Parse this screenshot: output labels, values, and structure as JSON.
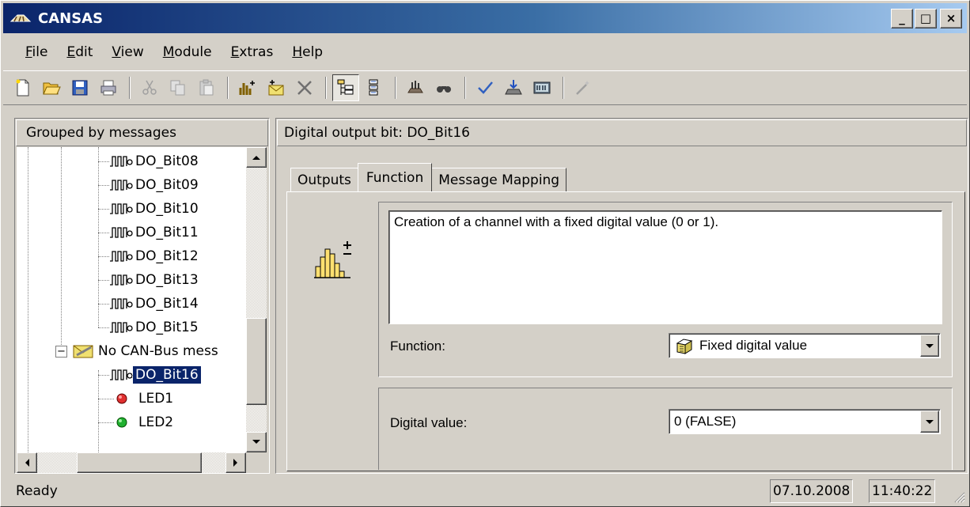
{
  "app": {
    "title": "CANSAS",
    "icon": "cansas-app-icon"
  },
  "window_buttons": {
    "minimize": "_",
    "maximize": "□",
    "close": "×"
  },
  "menu": {
    "items": [
      {
        "label": "File",
        "key": "F",
        "rest": "ile"
      },
      {
        "label": "Edit",
        "key": "E",
        "rest": "dit"
      },
      {
        "label": "View",
        "key": "V",
        "rest": "iew"
      },
      {
        "label": "Module",
        "key": "M",
        "rest": "odule"
      },
      {
        "label": "Extras",
        "key": "E",
        "rest": "xtras"
      },
      {
        "label": "Help",
        "key": "H",
        "rest": "elp"
      }
    ]
  },
  "toolbar": {
    "icons": [
      "new-file-icon",
      "open-folder-icon",
      "save-icon",
      "print-icon",
      "cut-icon",
      "copy-icon",
      "paste-icon",
      "add-channel-icon",
      "add-message-icon",
      "delete-icon",
      "grouped-by-messages-icon",
      "grouped-by-channels-icon",
      "integrate-icon",
      "search-icon",
      "check-icon",
      "download-icon",
      "measure-icon",
      "magic-wand-icon"
    ],
    "pressed": "grouped-by-messages-icon"
  },
  "left_panel": {
    "header": "Grouped by messages",
    "tree": [
      {
        "label": "DO_Bit08",
        "icon": "digital-signal-icon"
      },
      {
        "label": "DO_Bit09",
        "icon": "digital-signal-icon"
      },
      {
        "label": "DO_Bit10",
        "icon": "digital-signal-icon"
      },
      {
        "label": "DO_Bit11",
        "icon": "digital-signal-icon"
      },
      {
        "label": "DO_Bit12",
        "icon": "digital-signal-icon"
      },
      {
        "label": "DO_Bit13",
        "icon": "digital-signal-icon"
      },
      {
        "label": "DO_Bit14",
        "icon": "digital-signal-icon"
      },
      {
        "label": "DO_Bit15",
        "icon": "digital-signal-icon"
      },
      {
        "label": "No CAN-Bus mess",
        "icon": "no-can-message-icon",
        "expanded": true
      },
      {
        "label": "DO_Bit16",
        "icon": "digital-signal-icon",
        "selected": true
      },
      {
        "label": "LED1",
        "icon": "red-led-icon"
      },
      {
        "label": "LED2",
        "icon": "green-led-icon"
      }
    ]
  },
  "right_panel": {
    "header": "Digital output bit: DO_Bit16",
    "tabs": [
      "Outputs",
      "Function",
      "Message Mapping"
    ],
    "active_tab": "Function",
    "description": "Creation of a channel with a fixed digital value (0 or 1).",
    "function_label": "Function:",
    "function_value": "Fixed digital value",
    "function_value_icon": "fixed-value-cube-icon",
    "digital_value_label": "Digital value:",
    "digital_value": "0 (FALSE)"
  },
  "status": {
    "text": "Ready",
    "date": "07.10.2008",
    "time": "11:40:22"
  }
}
